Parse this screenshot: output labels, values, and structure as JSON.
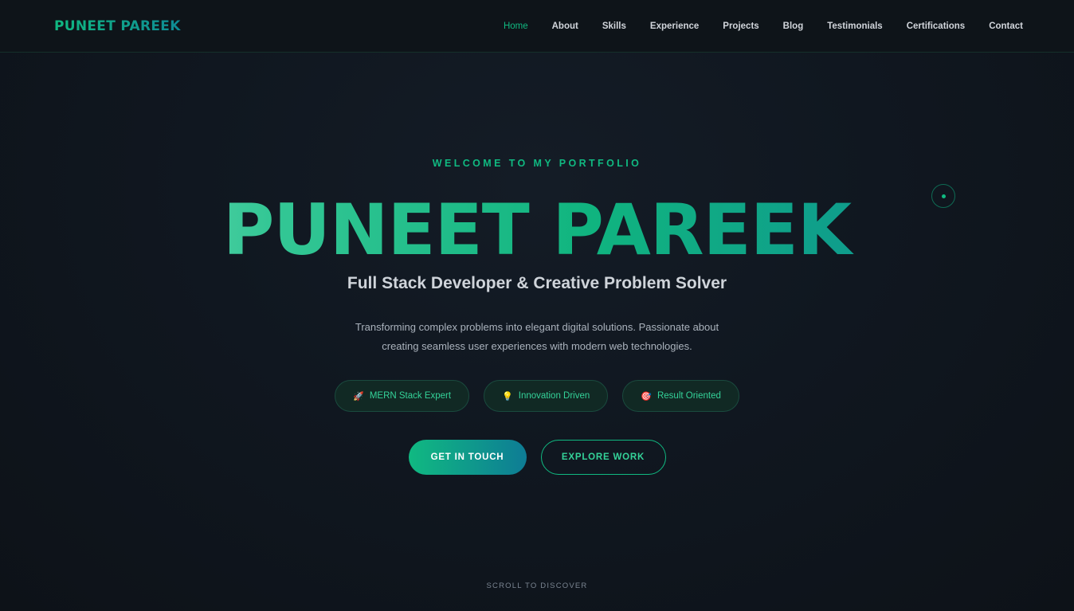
{
  "nav": {
    "brand": "PUNEET PAREEK",
    "links": [
      {
        "label": "Home"
      },
      {
        "label": "About"
      },
      {
        "label": "Skills"
      },
      {
        "label": "Experience"
      },
      {
        "label": "Projects"
      },
      {
        "label": "Blog"
      },
      {
        "label": "Testimonials"
      },
      {
        "label": "Certifications"
      },
      {
        "label": "Contact"
      }
    ],
    "active": "Home"
  },
  "hero": {
    "eyebrow": "WELCOME TO MY PORTFOLIO",
    "name": "PUNEET PAREEK",
    "title": "Full Stack Developer & Creative Problem Solver",
    "description": "Transforming complex problems into elegant digital solutions. Passionate about creating seamless user experiences with modern web technologies.",
    "badges": [
      {
        "icon": "🚀",
        "icon_name": "rocket-icon",
        "label": "MERN Stack Expert"
      },
      {
        "icon": "💡",
        "icon_name": "lightbulb-icon",
        "label": "Innovation Driven"
      },
      {
        "icon": "🎯",
        "icon_name": "target-icon",
        "label": "Result Oriented"
      }
    ],
    "primary_cta": "GET IN TOUCH",
    "secondary_cta": "EXPLORE WORK",
    "scroll_hint": "SCROLL TO DISCOVER"
  },
  "colors": {
    "accent": "#10b981",
    "accent_secondary": "#0e7c95",
    "background": "#101720"
  }
}
